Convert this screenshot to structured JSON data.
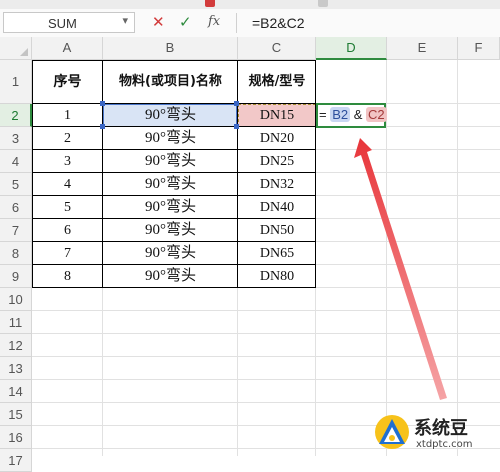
{
  "formula_bar": {
    "name_box": "SUM",
    "cancel_icon": "✕",
    "confirm_icon": "✓",
    "fx_label": "fx",
    "formula": "=B2&C2"
  },
  "columns": [
    "A",
    "B",
    "C",
    "D",
    "E",
    "F"
  ],
  "active_column": "D",
  "rows": [
    "1",
    "2",
    "3",
    "4",
    "5",
    "6",
    "7",
    "8",
    "9",
    "10",
    "11",
    "12",
    "13",
    "14",
    "15",
    "16",
    "17"
  ],
  "active_row": "2",
  "table": {
    "headers": [
      "序号",
      "物料(或项目)名称",
      "规格/型号"
    ],
    "rows": [
      [
        "1",
        "90°弯头",
        "DN15"
      ],
      [
        "2",
        "90°弯头",
        "DN20"
      ],
      [
        "3",
        "90°弯头",
        "DN25"
      ],
      [
        "4",
        "90°弯头",
        "DN32"
      ],
      [
        "5",
        "90°弯头",
        "DN40"
      ],
      [
        "6",
        "90°弯头",
        "DN50"
      ],
      [
        "7",
        "90°弯头",
        "DN65"
      ],
      [
        "8",
        "90°弯头",
        "DN80"
      ]
    ]
  },
  "editing_cell": {
    "address": "D2",
    "prefix": "=",
    "ref1": "B2",
    "operator": "&",
    "ref2": "C2"
  },
  "annotation": {
    "arrow_color": "#e8353a"
  },
  "watermark": {
    "title": "系统豆",
    "url": "xtdptc.com"
  },
  "colors": {
    "active_green": "#2e8b3e",
    "ref_blue_fill": "#d9e4f5",
    "ref_red_fill": "#f2c8c8"
  }
}
